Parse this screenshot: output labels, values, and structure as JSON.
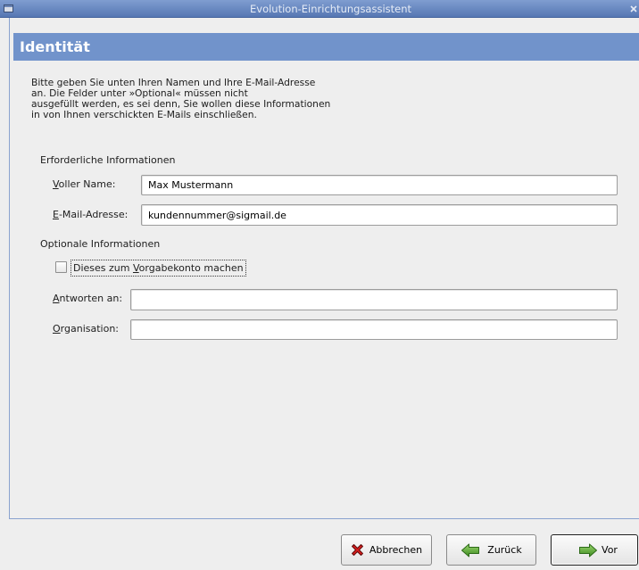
{
  "window": {
    "title": "Evolution-Einrichtungsassistent",
    "menu_icon": "window-menu-icon",
    "close_icon": "close-icon"
  },
  "page": {
    "title": "Identität",
    "intro_lines": [
      "Bitte geben Sie unten Ihren Namen und Ihre E-Mail-Adresse",
      "an. Die Felder unter »Optional« müssen nicht",
      "ausgefüllt werden, es sei denn, Sie wollen diese Informationen",
      "in von Ihnen verschickten E-Mails einschließen."
    ],
    "required": {
      "heading": "Erforderliche Informationen",
      "full_name": {
        "label": "Voller Name:",
        "value": "Max Mustermann"
      },
      "email": {
        "label": "E-Mail-Adresse:",
        "value": "kundennummer@sigmail.de"
      }
    },
    "optional": {
      "heading": "Optionale Informationen",
      "default_account": {
        "label": "Dieses zum Vorgabekonto machen",
        "checked": false
      },
      "reply_to": {
        "label": "Antworten an:",
        "value": ""
      },
      "organization": {
        "label": "Organisation:",
        "value": ""
      }
    }
  },
  "buttons": {
    "cancel": {
      "label": "Abbrechen",
      "icon": "cancel-icon"
    },
    "back": {
      "label": "Zurück",
      "icon": "arrow-left-icon"
    },
    "forward": {
      "label": "Vor",
      "icon": "arrow-right-icon"
    }
  },
  "colors": {
    "titlebar_top": "#7f9dd0",
    "titlebar_bottom": "#5677b3",
    "title_text": "#e6ecf6",
    "header": "#7193cb",
    "window_bg": "#eeeeee",
    "frame": "#8aa2cf",
    "cancel_icon": "#d41c1c",
    "arrow_light": "#9ad66f",
    "arrow_dark": "#3d8a1f"
  }
}
